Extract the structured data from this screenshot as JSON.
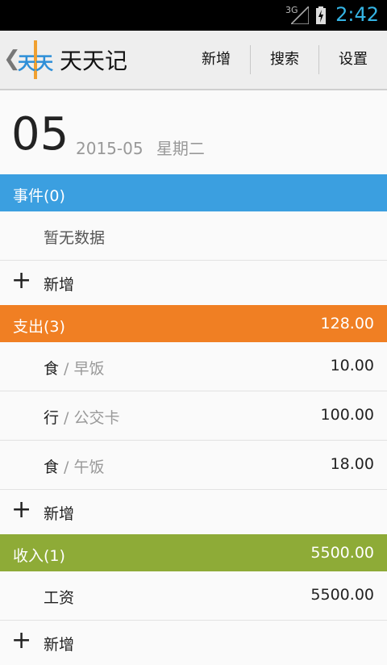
{
  "status_bar": {
    "network": "3G",
    "time": "2:42"
  },
  "action_bar": {
    "back_glyph": "❮",
    "logo_text": "天天",
    "title": "天天记",
    "buttons": {
      "add": "新增",
      "search": "搜索",
      "settings": "设置"
    }
  },
  "date": {
    "day": "05",
    "year_month": "2015-05",
    "weekday": "星期二"
  },
  "sections": {
    "events": {
      "title": "事件(0)",
      "color": "#3b9fe0",
      "empty_text": "暂无数据",
      "add_label": "新增"
    },
    "expense": {
      "title": "支出(3)",
      "total": "128.00",
      "color": "#f07f23",
      "items": [
        {
          "category": "食",
          "sep": " / ",
          "subcategory": "早饭",
          "amount": "10.00"
        },
        {
          "category": "行",
          "sep": " / ",
          "subcategory": "公交卡",
          "amount": "100.00"
        },
        {
          "category": "食",
          "sep": " / ",
          "subcategory": "午饭",
          "amount": "18.00"
        }
      ],
      "add_label": "新增"
    },
    "income": {
      "title": "收入(1)",
      "total": "5500.00",
      "color": "#8eab37",
      "items": [
        {
          "category": "工资",
          "amount": "5500.00"
        }
      ],
      "add_label": "新增"
    }
  },
  "icons": {
    "plus": "+"
  }
}
